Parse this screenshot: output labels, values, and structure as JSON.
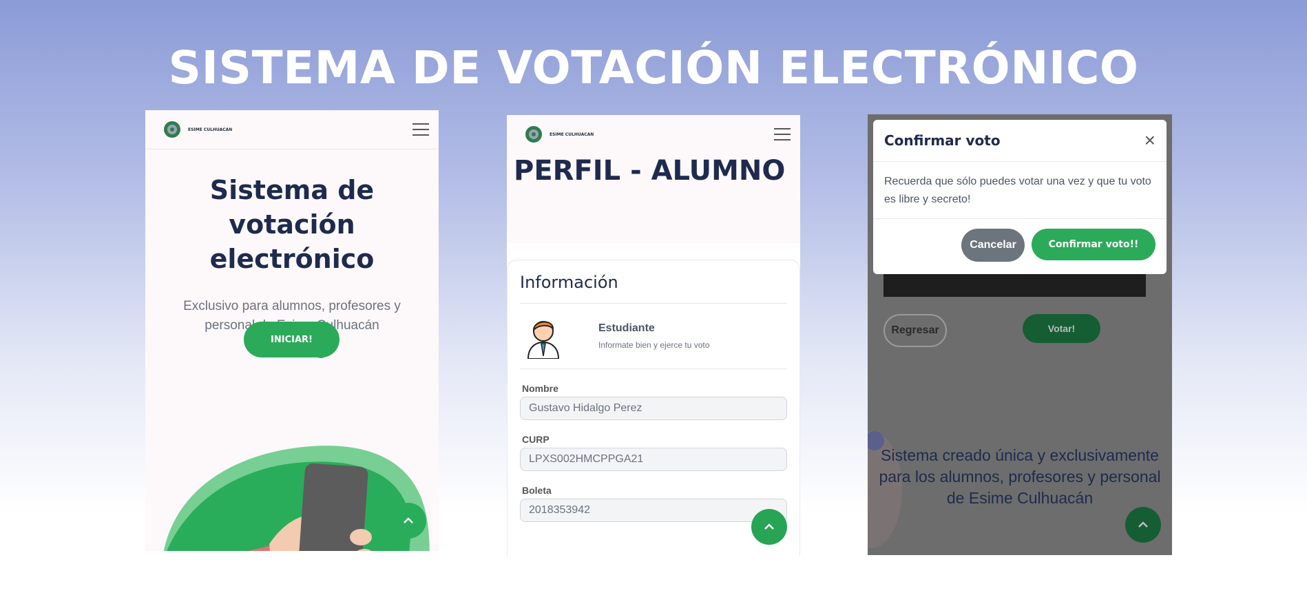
{
  "page": {
    "title": "SISTEMA DE VOTACIÓN ELECTRÓNICO"
  },
  "brand": {
    "name": "ESIME CULHUACAN"
  },
  "screen1": {
    "title": "Sistema de votación electrónico",
    "subtitle": "Exclusivo para alumnos, profesores y personal de Esime Culhuacán",
    "button": "INICIAR!"
  },
  "screen2": {
    "title": "PERFIL - ALUMNO",
    "card_title": "Información",
    "role": {
      "title": "Estudiante",
      "subtitle": "Informate bien y ejerce tu voto"
    },
    "fields": [
      {
        "label": "Nombre",
        "value": "Gustavo Hidalgo Perez"
      },
      {
        "label": "CURP",
        "value": "LPXS002HMCPPGA21"
      },
      {
        "label": "Boleta",
        "value": "2018353942"
      }
    ]
  },
  "screen3": {
    "modal": {
      "title": "Confirmar voto",
      "body": "Recuerda que sólo puedes votar una vez y que tu voto es libre y secreto!",
      "cancel": "Cancelar",
      "confirm": "Confirmar voto!!"
    },
    "back_button": "Regresar",
    "vote_button": "Votar!",
    "footer_text": "Sistema creado única y exclusivamente para los alumnos, profesores y personal de Esime Culhuacán"
  },
  "icons": {
    "menu": "hamburger-icon",
    "scroll_top": "chevron-up-icon",
    "close": "close-icon",
    "avatar": "student-avatar-icon"
  },
  "colors": {
    "primary_green": "#2bab59",
    "title_navy": "#1e2b4d",
    "cancel_gray": "#6c757d"
  }
}
